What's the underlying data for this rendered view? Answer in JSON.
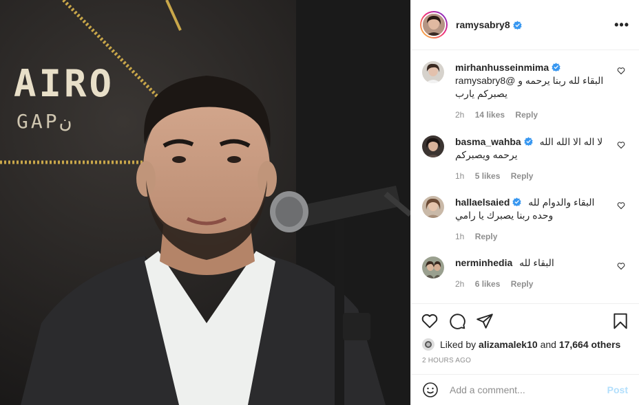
{
  "photo": {
    "sign_text_1": "AIRO",
    "sign_text_2": "GAPن"
  },
  "header": {
    "username": "ramysabry8",
    "verified": true,
    "more_label": "•••"
  },
  "comments": [
    {
      "username": "mirhanhusseinmima",
      "verified": true,
      "line1": "البقاء لله ربنا يرحمه و @ramysabry8",
      "line2": "يصبركم يارب",
      "time": "2h",
      "likes": "14 likes",
      "reply": "Reply"
    },
    {
      "username": "basma_wahba",
      "verified": true,
      "line1": "لا اله الا الله الله",
      "line2": "يرحمه ويصبركم",
      "time": "1h",
      "likes": "5 likes",
      "reply": "Reply"
    },
    {
      "username": "hallaelsaied",
      "verified": true,
      "line1": "البقاء والدوام لله",
      "line2": "وحده ربنا يصبرك يا رامي",
      "time": "1h",
      "likes": "",
      "reply": "Reply"
    },
    {
      "username": "nerminhedia",
      "verified": false,
      "line1": "البقاء لله",
      "line2": "",
      "time": "2h",
      "likes": "6 likes",
      "reply": "Reply"
    }
  ],
  "likes": {
    "prefix": "Liked by",
    "user": "alizamalek10",
    "connector": "and",
    "others": "17,664 others"
  },
  "timestamp": "2 HOURS AGO",
  "add_comment": {
    "placeholder": "Add a comment...",
    "post_label": "Post"
  },
  "colors": {
    "verified": "#3897f0",
    "post_disabled": "#b2dffc",
    "meta": "#8e8e8e"
  }
}
